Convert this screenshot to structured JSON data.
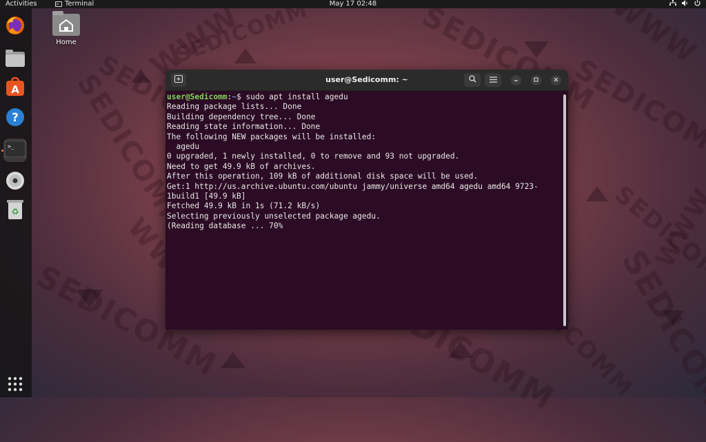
{
  "topbar": {
    "activities": "Activities",
    "app_name": "Terminal",
    "clock": "May 17  02:48",
    "status_icons": [
      "network-icon",
      "volume-icon",
      "power-icon"
    ]
  },
  "dock": {
    "items": [
      {
        "name": "firefox",
        "icon": "firefox-icon"
      },
      {
        "name": "files",
        "icon": "files-icon"
      },
      {
        "name": "software",
        "icon": "app-center-icon"
      },
      {
        "name": "help",
        "icon": "help-icon"
      },
      {
        "name": "terminal",
        "icon": "terminal-icon",
        "active": true
      },
      {
        "name": "disc",
        "icon": "disc-icon"
      },
      {
        "name": "trash",
        "icon": "trash-icon"
      }
    ],
    "show_apps_icon": "grid-icon"
  },
  "desktop": {
    "home_label": "Home"
  },
  "terminal": {
    "title": "user@Sedicomm: ~",
    "prompt_user": "user@Sedicomm",
    "prompt_sep": ":",
    "prompt_path": "~",
    "command": "$ sudo apt install agedu",
    "output": [
      "Reading package lists... Done",
      "Building dependency tree... Done",
      "Reading state information... Done",
      "The following NEW packages will be installed:",
      "  agedu",
      "0 upgraded, 1 newly installed, 0 to remove and 93 not upgraded.",
      "Need to get 49.9 kB of archives.",
      "After this operation, 109 kB of additional disk space will be used.",
      "Get:1 http://us.archive.ubuntu.com/ubuntu jammy/universe amd64 agedu amd64 9723-",
      "1build1 [49.9 kB]",
      "Fetched 49.9 kB in 1s (71.2 kB/s)",
      "Selecting previously unselected package agedu.",
      "(Reading database ... 70%"
    ],
    "colors": {
      "background": "#2c0c24",
      "prompt_user": "#7fd35b",
      "prompt_path": "#6b8fd6"
    }
  },
  "wallpaper": {
    "watermark": "SEDICOMM",
    "watermark_alt": "WWW"
  }
}
